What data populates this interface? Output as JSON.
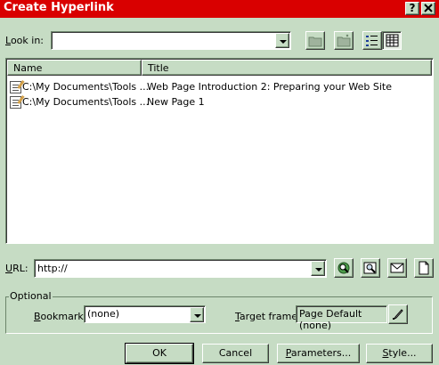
{
  "window": {
    "title": "Create Hyperlink",
    "help_label": "?",
    "close_label": "X"
  },
  "look_in": {
    "label": "Look in:",
    "value": ""
  },
  "file_list": {
    "columns": [
      "Name",
      "Title"
    ],
    "rows": [
      {
        "name": "C:\\My Documents\\Tools ...",
        "title": "Web Page Introduction 2: Preparing your Web Site"
      },
      {
        "name": "C:\\My Documents\\Tools ...",
        "title": "New Page 1"
      }
    ]
  },
  "url": {
    "label": "URL:",
    "value": "http://"
  },
  "optional": {
    "legend": "Optional",
    "bookmark_label": "Bookmark:",
    "bookmark_value": "(none)",
    "target_label": "Target frame:",
    "target_value": "Page Default (none)"
  },
  "buttons": {
    "ok": "OK",
    "cancel": "Cancel",
    "parameters": "Parameters...",
    "style": "Style..."
  },
  "colors": {
    "titlebar": "#d90000",
    "face": "#c6dcc4"
  },
  "icons": [
    "folder-up-icon",
    "new-folder-icon",
    "list-view-icon",
    "details-view-icon",
    "web-browse-icon",
    "file-browse-icon",
    "email-icon",
    "new-page-icon",
    "pencil-icon",
    "dropdown-arrow-icon"
  ]
}
